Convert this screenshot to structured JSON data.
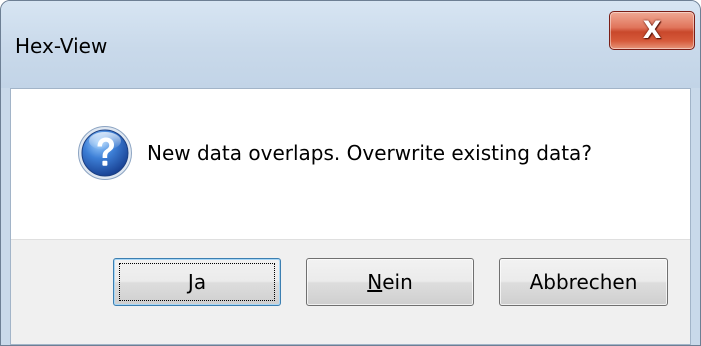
{
  "window": {
    "title": "Hex-View",
    "close_glyph": "X"
  },
  "dialog": {
    "icon": "question-icon",
    "message": "New data overlaps. Overwrite existing data?"
  },
  "buttons": {
    "yes_label": "Ja",
    "no_label": "Nein",
    "cancel_label": "Abbrechen"
  },
  "colors": {
    "titlebar": "#c9d9ea",
    "close_button": "#c9482b",
    "icon_blue": "#2a5fb8",
    "button_area": "#f0f0f0"
  }
}
